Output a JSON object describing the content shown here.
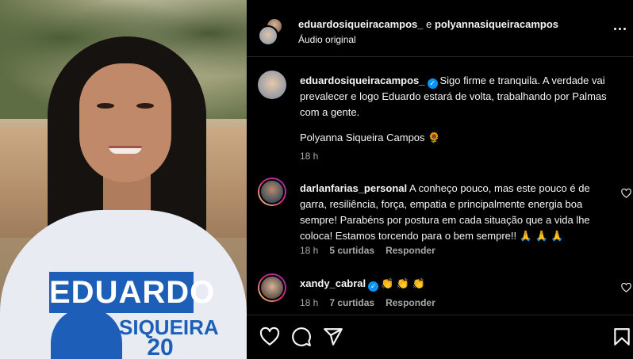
{
  "header": {
    "user1": "eduardosiqueiracampos_",
    "connector": " e ",
    "user2": "polyannasiqueiracampos",
    "audio": "Áudio original"
  },
  "shirt": {
    "line1": "EDUARDO",
    "line2": "SIQUEIRA",
    "number": "20"
  },
  "caption": {
    "user": "eduardosiqueiracampos_",
    "text": "Sigo firme e tranquila. A verdade vai prevalecer e logo Eduardo estará de volta, trabalhando por Palmas com a gente.",
    "signature": "Polyanna Siqueira Campos 🌻",
    "time": "18 h"
  },
  "comments": [
    {
      "user": "darlanfarias_personal",
      "text": "A conheço pouco, mas este pouco é de garra, resiliência, força, empatia e principalmente energia boa sempre! Parabéns por postura em cada situação que a vida lhe coloca! Estamos torcendo para o bem sempre!! 🙏 🙏 🙏",
      "time": "18 h",
      "likes": "5 curtidas",
      "reply": "Responder"
    },
    {
      "user": "xandy_cabral",
      "text": "👏 👏 👏",
      "time": "18 h",
      "likes": "7 curtidas",
      "reply": "Responder"
    }
  ],
  "icons": [
    "more-icon",
    "heart-icon",
    "comment-icon",
    "share-icon",
    "bookmark-icon",
    "verified-icon"
  ]
}
